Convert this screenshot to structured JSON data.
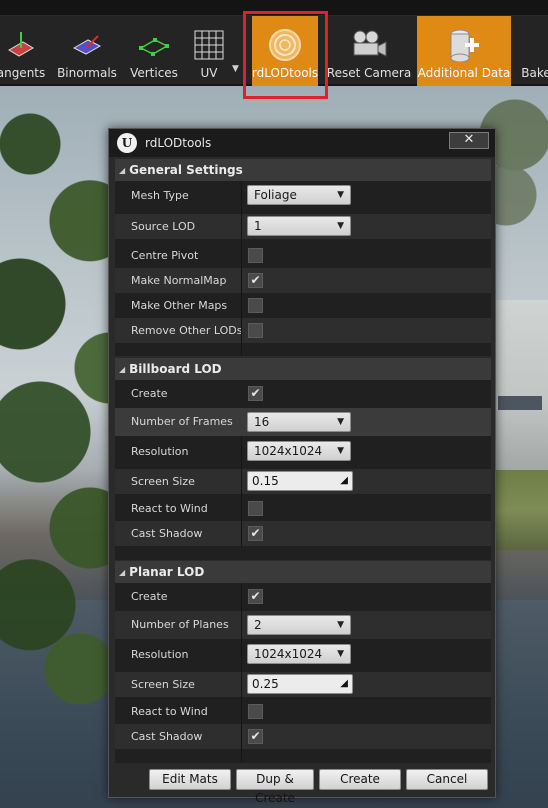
{
  "toolbar": {
    "buttons": [
      {
        "label": "angents",
        "icon": "tangents-icon"
      },
      {
        "label": "Binormals",
        "icon": "binormals-icon"
      },
      {
        "label": "Vertices",
        "icon": "vertices-icon"
      },
      {
        "label": "UV",
        "icon": "uv-grid-icon"
      },
      {
        "label": "rdLODtools",
        "icon": "rdlodtools-icon",
        "active": true
      },
      {
        "label": "Reset Camera",
        "icon": "camera-icon"
      },
      {
        "label": "Additional Data",
        "icon": "additional-data-icon",
        "active": true
      },
      {
        "label": "Bake",
        "icon": "bake-icon"
      }
    ]
  },
  "dialog": {
    "title": "rdLODtools",
    "close_label": "✕",
    "general": {
      "header": "General Settings",
      "mesh_type_label": "Mesh Type",
      "mesh_type_value": "Foliage",
      "source_lod_label": "Source LOD",
      "source_lod_value": "1",
      "centre_pivot_label": "Centre Pivot",
      "centre_pivot_checked": false,
      "make_normalmap_label": "Make NormalMap",
      "make_normalmap_checked": true,
      "make_other_maps_label": "Make Other Maps",
      "make_other_maps_checked": false,
      "remove_other_lods_label": "Remove Other LODs",
      "remove_other_lods_checked": false
    },
    "billboard": {
      "header": "Billboard LOD",
      "create_label": "Create",
      "create_checked": true,
      "frames_label": "Number of Frames",
      "frames_value": "16",
      "resolution_label": "Resolution",
      "resolution_value": "1024x1024",
      "screen_size_label": "Screen Size",
      "screen_size_value": "0.15",
      "react_wind_label": "React to Wind",
      "react_wind_checked": false,
      "cast_shadow_label": "Cast Shadow",
      "cast_shadow_checked": true
    },
    "planar": {
      "header": "Planar LOD",
      "create_label": "Create",
      "create_checked": true,
      "planes_label": "Number of Planes",
      "planes_value": "2",
      "resolution_label": "Resolution",
      "resolution_value": "1024x1024",
      "screen_size_label": "Screen Size",
      "screen_size_value": "0.25",
      "react_wind_label": "React to Wind",
      "react_wind_checked": false,
      "cast_shadow_label": "Cast Shadow",
      "cast_shadow_checked": true
    },
    "buttons": {
      "edit_mats": "Edit Mats",
      "dup_create": "Dup & Create",
      "create": "Create",
      "cancel": "Cancel"
    }
  },
  "colors": {
    "accent": "#e08a16",
    "highlight_box": "#e0202a"
  }
}
